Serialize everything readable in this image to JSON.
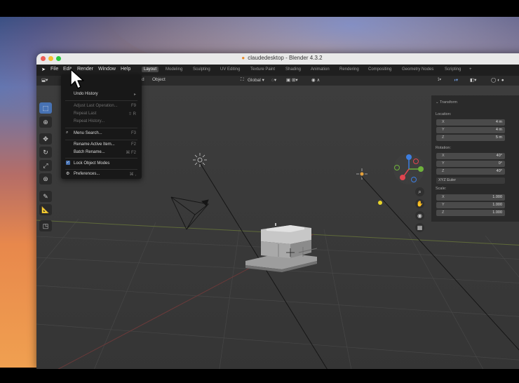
{
  "window": {
    "title": "claudedesktop - Blender 4.3.2"
  },
  "menubar": {
    "items": [
      "File",
      "Edit",
      "Render",
      "Window",
      "Help"
    ]
  },
  "workspaces": {
    "tabs": [
      "Layout",
      "Modeling",
      "Sculpting",
      "UV Editing",
      "Texture Paint",
      "Shading",
      "Animation",
      "Rendering",
      "Compositing",
      "Geometry Nodes",
      "Scripting"
    ],
    "active": "Layout",
    "add_label": "+"
  },
  "header": {
    "add_fragment": "d",
    "object_menu": "Object",
    "orientation": "Global"
  },
  "edit_menu": {
    "items": [
      {
        "label": "Undo History",
        "shortcut": "▸",
        "disabled": false
      },
      {
        "label": "Adjust Last Operation...",
        "shortcut": "F9",
        "disabled": true
      },
      {
        "label": "Repeat Last",
        "shortcut": "⇧ R",
        "disabled": true
      },
      {
        "label": "Repeat History...",
        "shortcut": "",
        "disabled": true
      },
      {
        "label": "Menu Search...",
        "shortcut": "F3",
        "disabled": false
      },
      {
        "label": "Rename Active Item...",
        "shortcut": "F2",
        "disabled": false
      },
      {
        "label": "Batch Rename...",
        "shortcut": "⌘ F2",
        "disabled": false
      },
      {
        "label": "Lock Object Modes",
        "shortcut": "",
        "disabled": false
      },
      {
        "label": "Preferences...",
        "shortcut": "⌘ ,",
        "disabled": false
      }
    ]
  },
  "transform_panel": {
    "header": "Transform",
    "location_label": "Location:",
    "location": [
      {
        "axis": "X",
        "value": "4 m"
      },
      {
        "axis": "Y",
        "value": "4 m"
      },
      {
        "axis": "Z",
        "value": "5 m"
      }
    ],
    "rotation_label": "Rotation:",
    "rotation": [
      {
        "axis": "X",
        "value": "40°"
      },
      {
        "axis": "Y",
        "value": "0°"
      },
      {
        "axis": "Z",
        "value": "40°"
      }
    ],
    "rotation_mode": "XYZ Euler",
    "scale_label": "Scale:",
    "scale": [
      {
        "axis": "X",
        "value": "1.000"
      },
      {
        "axis": "Y",
        "value": "1.000"
      },
      {
        "axis": "Z",
        "value": "1.000"
      }
    ]
  },
  "gizmo": {
    "x": "X",
    "y": "Y",
    "z": "Z"
  },
  "colors": {
    "accent": "#4772b3",
    "x_axis": "#e0454f",
    "y_axis": "#6fb23b",
    "z_axis": "#3d7ee0"
  }
}
